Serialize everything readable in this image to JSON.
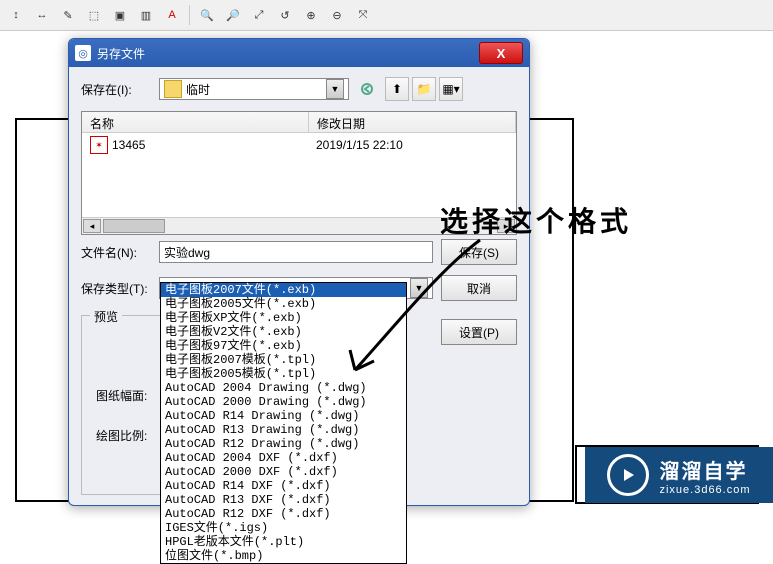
{
  "toolbar": {
    "items": [
      "↕",
      "↔",
      "✎",
      "⬚",
      "⬚",
      "▣",
      "A",
      "",
      "🔍",
      "🔎",
      "⤢",
      "↺",
      "⊕",
      "⊖",
      "⤧"
    ]
  },
  "dialog": {
    "title": "另存文件",
    "save_in_label": "保存在(I):",
    "save_in_value": "临时",
    "columns": {
      "name": "名称",
      "date": "修改日期"
    },
    "files": [
      {
        "name": "13465",
        "date": "2019/1/15 22:10"
      }
    ],
    "filename_label": "文件名(N):",
    "filename_value": "实验dwg",
    "filetype_label": "保存类型(T):",
    "filetype_value": "电子图板2007文件(*.exb)",
    "buttons": {
      "save": "保存(S)",
      "cancel": "取消",
      "setup": "设置(P)"
    },
    "preview_label": "预览",
    "sheet_label": "图纸幅面:",
    "scale_label": "绘图比例:",
    "options": [
      "电子图板2007文件(*.exb)",
      "电子图板2005文件(*.exb)",
      "电子图板XP文件(*.exb)",
      "电子图板V2文件(*.exb)",
      "电子图板97文件(*.exb)",
      "电子图板2007模板(*.tpl)",
      "电子图板2005模板(*.tpl)",
      "AutoCAD 2004 Drawing (*.dwg)",
      "AutoCAD 2000 Drawing (*.dwg)",
      "AutoCAD R14 Drawing (*.dwg)",
      "AutoCAD R13 Drawing (*.dwg)",
      "AutoCAD R12 Drawing (*.dwg)",
      "AutoCAD 2004 DXF (*.dxf)",
      "AutoCAD 2000 DXF (*.dxf)",
      "AutoCAD R14 DXF (*.dxf)",
      "AutoCAD R13 DXF (*.dxf)",
      "AutoCAD R12 DXF (*.dxf)",
      "IGES文件(*.igs)",
      "HPGL老版本文件(*.plt)",
      "位图文件(*.bmp)"
    ],
    "selected_option_index": 0
  },
  "annotation": "选择这个格式",
  "watermark": {
    "line1": "溜溜自学",
    "line2": "zixue.3d66.com"
  }
}
